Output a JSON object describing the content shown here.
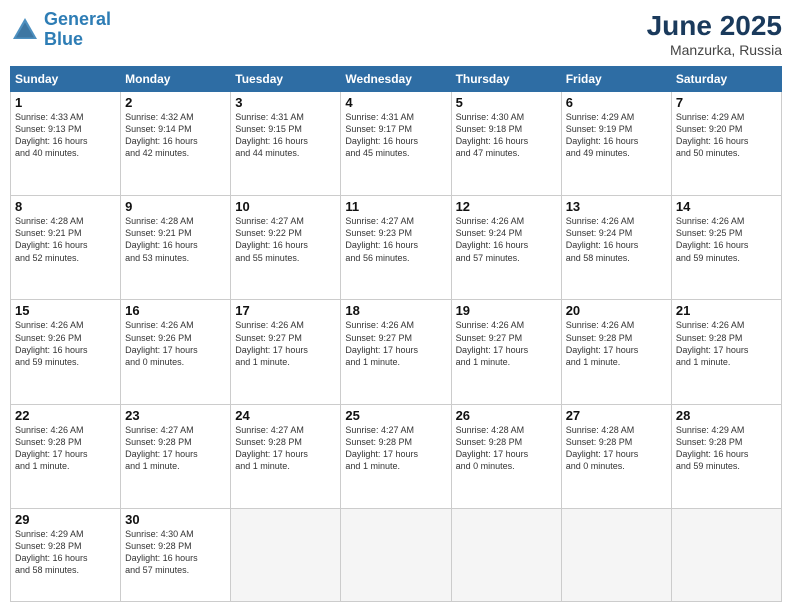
{
  "header": {
    "logo_line1": "General",
    "logo_line2": "Blue",
    "month_year": "June 2025",
    "location": "Manzurka, Russia"
  },
  "weekdays": [
    "Sunday",
    "Monday",
    "Tuesday",
    "Wednesday",
    "Thursday",
    "Friday",
    "Saturday"
  ],
  "weeks": [
    [
      {
        "day": "1",
        "info": "Sunrise: 4:33 AM\nSunset: 9:13 PM\nDaylight: 16 hours\nand 40 minutes."
      },
      {
        "day": "2",
        "info": "Sunrise: 4:32 AM\nSunset: 9:14 PM\nDaylight: 16 hours\nand 42 minutes."
      },
      {
        "day": "3",
        "info": "Sunrise: 4:31 AM\nSunset: 9:15 PM\nDaylight: 16 hours\nand 44 minutes."
      },
      {
        "day": "4",
        "info": "Sunrise: 4:31 AM\nSunset: 9:17 PM\nDaylight: 16 hours\nand 45 minutes."
      },
      {
        "day": "5",
        "info": "Sunrise: 4:30 AM\nSunset: 9:18 PM\nDaylight: 16 hours\nand 47 minutes."
      },
      {
        "day": "6",
        "info": "Sunrise: 4:29 AM\nSunset: 9:19 PM\nDaylight: 16 hours\nand 49 minutes."
      },
      {
        "day": "7",
        "info": "Sunrise: 4:29 AM\nSunset: 9:20 PM\nDaylight: 16 hours\nand 50 minutes."
      }
    ],
    [
      {
        "day": "8",
        "info": "Sunrise: 4:28 AM\nSunset: 9:21 PM\nDaylight: 16 hours\nand 52 minutes."
      },
      {
        "day": "9",
        "info": "Sunrise: 4:28 AM\nSunset: 9:21 PM\nDaylight: 16 hours\nand 53 minutes."
      },
      {
        "day": "10",
        "info": "Sunrise: 4:27 AM\nSunset: 9:22 PM\nDaylight: 16 hours\nand 55 minutes."
      },
      {
        "day": "11",
        "info": "Sunrise: 4:27 AM\nSunset: 9:23 PM\nDaylight: 16 hours\nand 56 minutes."
      },
      {
        "day": "12",
        "info": "Sunrise: 4:26 AM\nSunset: 9:24 PM\nDaylight: 16 hours\nand 57 minutes."
      },
      {
        "day": "13",
        "info": "Sunrise: 4:26 AM\nSunset: 9:24 PM\nDaylight: 16 hours\nand 58 minutes."
      },
      {
        "day": "14",
        "info": "Sunrise: 4:26 AM\nSunset: 9:25 PM\nDaylight: 16 hours\nand 59 minutes."
      }
    ],
    [
      {
        "day": "15",
        "info": "Sunrise: 4:26 AM\nSunset: 9:26 PM\nDaylight: 16 hours\nand 59 minutes."
      },
      {
        "day": "16",
        "info": "Sunrise: 4:26 AM\nSunset: 9:26 PM\nDaylight: 17 hours\nand 0 minutes."
      },
      {
        "day": "17",
        "info": "Sunrise: 4:26 AM\nSunset: 9:27 PM\nDaylight: 17 hours\nand 1 minute."
      },
      {
        "day": "18",
        "info": "Sunrise: 4:26 AM\nSunset: 9:27 PM\nDaylight: 17 hours\nand 1 minute."
      },
      {
        "day": "19",
        "info": "Sunrise: 4:26 AM\nSunset: 9:27 PM\nDaylight: 17 hours\nand 1 minute."
      },
      {
        "day": "20",
        "info": "Sunrise: 4:26 AM\nSunset: 9:28 PM\nDaylight: 17 hours\nand 1 minute."
      },
      {
        "day": "21",
        "info": "Sunrise: 4:26 AM\nSunset: 9:28 PM\nDaylight: 17 hours\nand 1 minute."
      }
    ],
    [
      {
        "day": "22",
        "info": "Sunrise: 4:26 AM\nSunset: 9:28 PM\nDaylight: 17 hours\nand 1 minute."
      },
      {
        "day": "23",
        "info": "Sunrise: 4:27 AM\nSunset: 9:28 PM\nDaylight: 17 hours\nand 1 minute."
      },
      {
        "day": "24",
        "info": "Sunrise: 4:27 AM\nSunset: 9:28 PM\nDaylight: 17 hours\nand 1 minute."
      },
      {
        "day": "25",
        "info": "Sunrise: 4:27 AM\nSunset: 9:28 PM\nDaylight: 17 hours\nand 1 minute."
      },
      {
        "day": "26",
        "info": "Sunrise: 4:28 AM\nSunset: 9:28 PM\nDaylight: 17 hours\nand 0 minutes."
      },
      {
        "day": "27",
        "info": "Sunrise: 4:28 AM\nSunset: 9:28 PM\nDaylight: 17 hours\nand 0 minutes."
      },
      {
        "day": "28",
        "info": "Sunrise: 4:29 AM\nSunset: 9:28 PM\nDaylight: 16 hours\nand 59 minutes."
      }
    ],
    [
      {
        "day": "29",
        "info": "Sunrise: 4:29 AM\nSunset: 9:28 PM\nDaylight: 16 hours\nand 58 minutes."
      },
      {
        "day": "30",
        "info": "Sunrise: 4:30 AM\nSunset: 9:28 PM\nDaylight: 16 hours\nand 57 minutes."
      },
      {
        "day": "",
        "info": ""
      },
      {
        "day": "",
        "info": ""
      },
      {
        "day": "",
        "info": ""
      },
      {
        "day": "",
        "info": ""
      },
      {
        "day": "",
        "info": ""
      }
    ]
  ]
}
